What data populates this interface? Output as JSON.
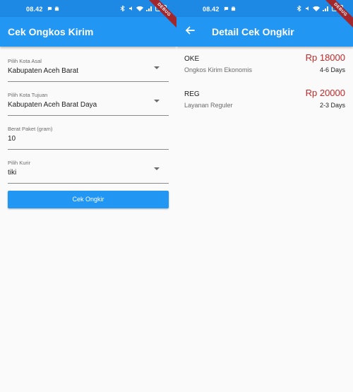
{
  "status_bar": {
    "time": "08.42",
    "battery": "100"
  },
  "debug_banner": "DEBUG",
  "form_screen": {
    "title": "Cek Ongkos Kirim",
    "origin": {
      "label": "Pilih Kota Asal",
      "value": "Kabupaten Aceh Barat"
    },
    "destination": {
      "label": "Pilih Kota Tujuan",
      "value": "Kabupaten Aceh Barat Daya"
    },
    "weight": {
      "label": "Berat Paket (gram)",
      "value": "10"
    },
    "courier": {
      "label": "Pilih Kurir",
      "value": "tiki"
    },
    "submit_label": "Cek Ongkir"
  },
  "detail_screen": {
    "title": "Detail Cek Ongkir",
    "services": [
      {
        "code": "OKE",
        "description": "Ongkos Kirim Ekonomis",
        "price": "Rp 18000",
        "etd": "4-6 Days"
      },
      {
        "code": "REG",
        "description": "Layanan Reguler",
        "price": "Rp 20000",
        "etd": "2-3 Days"
      }
    ]
  },
  "colors": {
    "app_bar": "#2196f3",
    "status_bar": "#1e88e5",
    "price": "#c62828",
    "debug": "#a1272d"
  }
}
